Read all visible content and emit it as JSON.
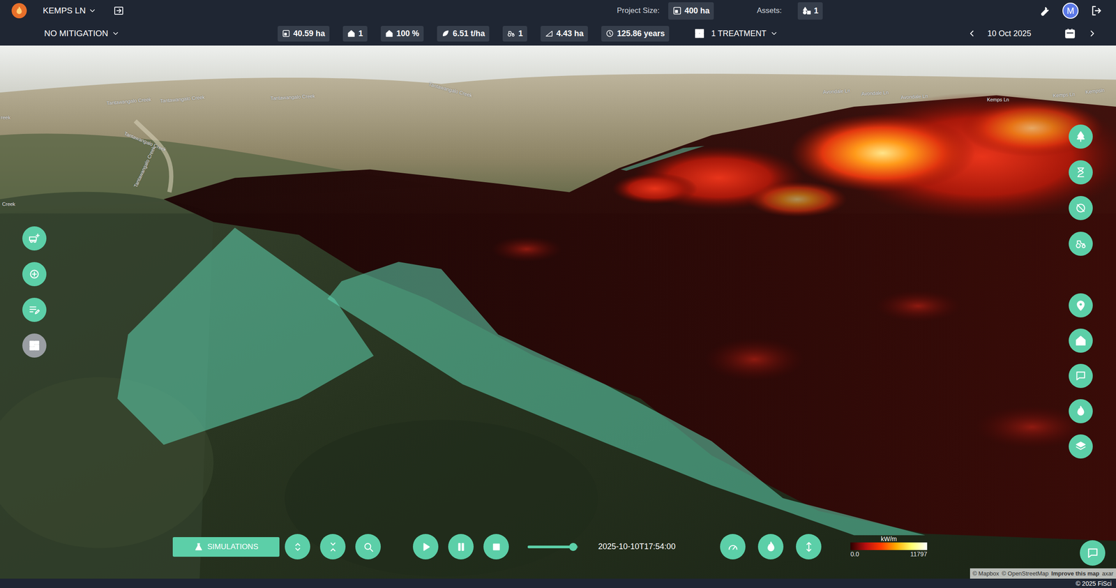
{
  "header": {
    "project": "KEMPS LN",
    "project_size_label": "Project Size:",
    "project_size": "400 ha",
    "assets_label": "Assets:",
    "assets": "1",
    "avatar": "M"
  },
  "toolbar": {
    "mitigation": "NO MITIGATION",
    "stats": [
      {
        "kind": "area",
        "value": "40.59 ha"
      },
      {
        "kind": "house",
        "value": "1"
      },
      {
        "kind": "house",
        "value": "100 %"
      },
      {
        "kind": "fuel",
        "value": "6.51 t/ha"
      },
      {
        "kind": "tractor",
        "value": "1"
      },
      {
        "kind": "slope",
        "value": "4.43 ha"
      },
      {
        "kind": "clock",
        "value": "125.86 years"
      }
    ],
    "treatment": "1 TREATMENT",
    "date": "10 Oct 2025"
  },
  "map": {
    "labels": [
      "Tantawangalo Creek",
      "Tantawangalo Creek",
      "Tantawangalo Creek",
      "Tantawangalo Creek",
      "Tantawangalo Creek",
      "Tantawangalo Creek",
      "reek",
      "Creek",
      "Avondale Ln",
      "Avondale Ln",
      "Avondale Ln",
      "Kemps Ln",
      "Kemps Ln",
      "Kempsln"
    ],
    "left_tools": [
      {
        "kind": "vehicle-add",
        "disabled": false
      },
      {
        "kind": "zoom-plus",
        "disabled": false
      },
      {
        "kind": "edit-list",
        "disabled": false
      },
      {
        "kind": "dashboard",
        "disabled": true
      }
    ],
    "right_tools_top": [
      {
        "kind": "tree"
      },
      {
        "kind": "hourglass"
      },
      {
        "kind": "eye-off"
      },
      {
        "kind": "tractor"
      }
    ],
    "right_tools_bottom": [
      {
        "kind": "pin"
      },
      {
        "kind": "house"
      },
      {
        "kind": "chat"
      },
      {
        "kind": "flame"
      },
      {
        "kind": "layers"
      }
    ],
    "attribution": {
      "mapbox": "© Mapbox",
      "osm": "© OpenStreetMap",
      "improve": "Improve this map",
      "maxar": "axar"
    }
  },
  "playback": {
    "simulations": "SIMULATIONS",
    "left_buttons": [
      {
        "kind": "expand"
      },
      {
        "kind": "collapse"
      },
      {
        "kind": "search"
      }
    ],
    "transport": [
      {
        "kind": "play"
      },
      {
        "kind": "pause"
      },
      {
        "kind": "stop"
      }
    ],
    "level": 0.9,
    "time": "2025-10-10T17:54:00",
    "right_buttons": [
      {
        "kind": "gauge"
      },
      {
        "kind": "flame"
      },
      {
        "kind": "arrows-v"
      }
    ]
  },
  "legend": {
    "unit": "kW/m",
    "min": "0.0",
    "max": "11797"
  },
  "footer": "© 2025 FiSci"
}
